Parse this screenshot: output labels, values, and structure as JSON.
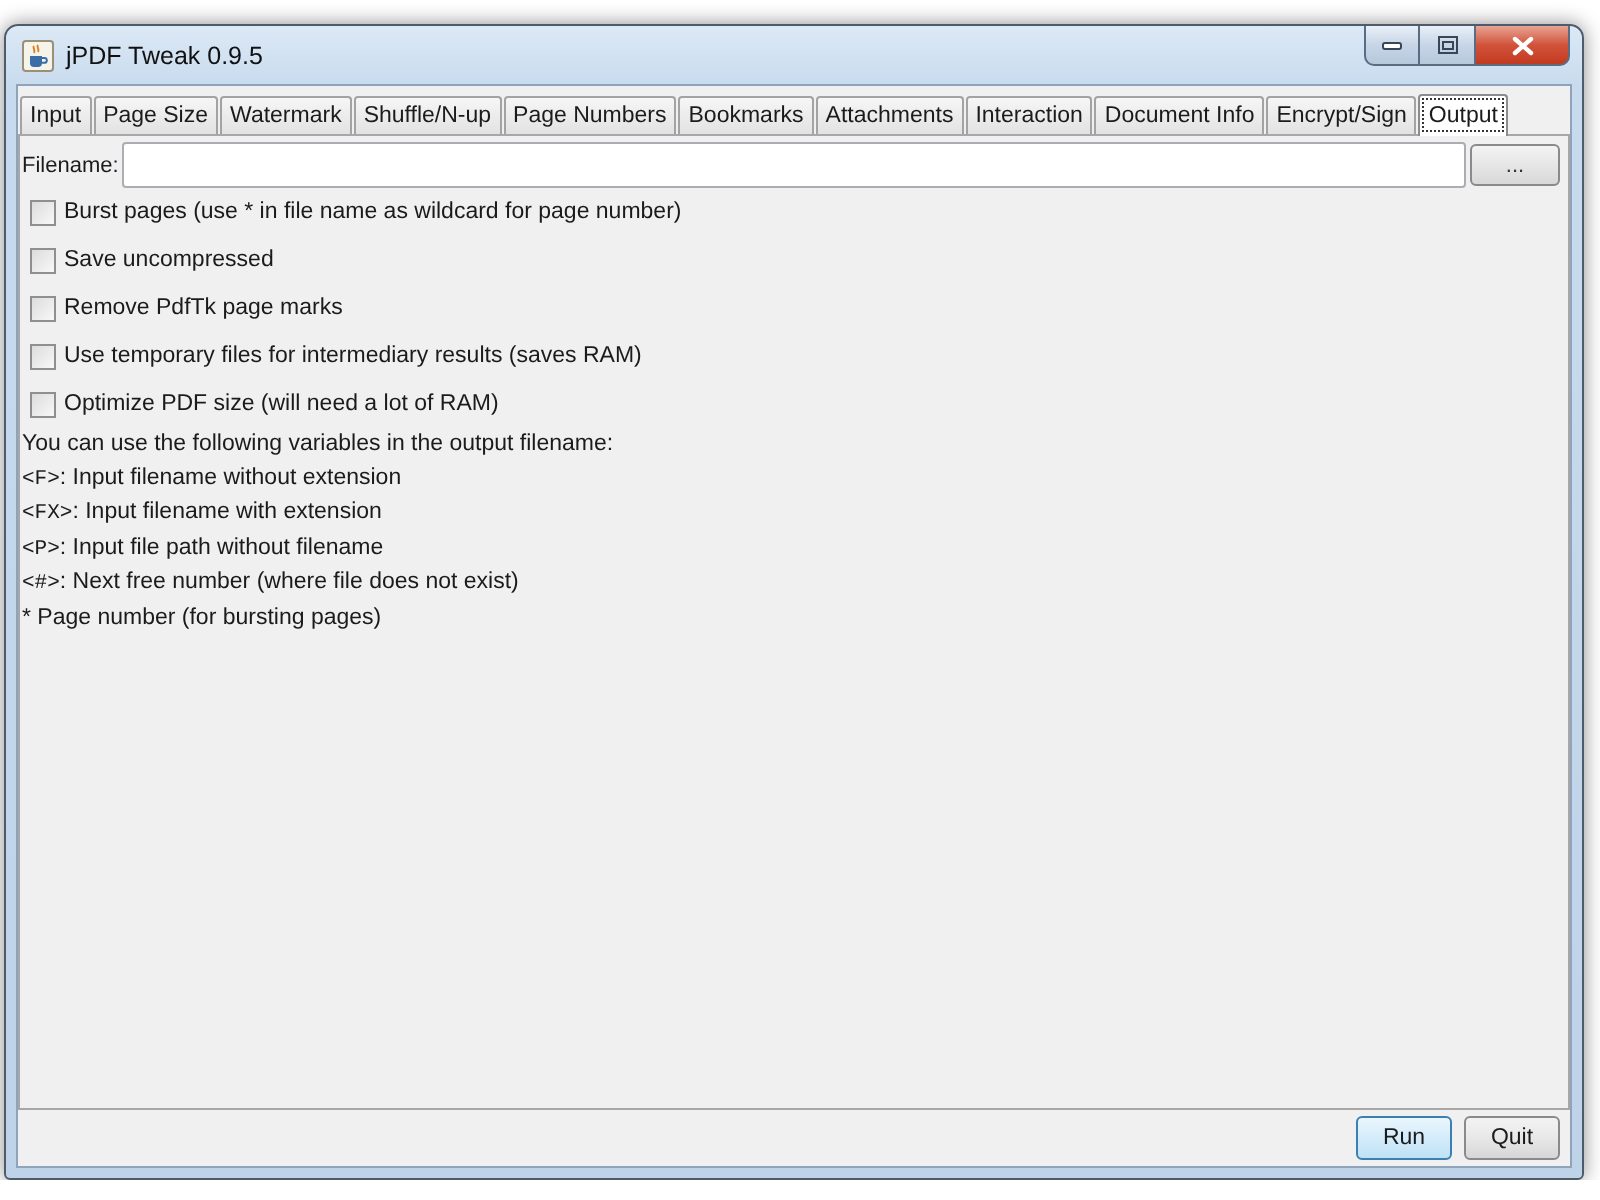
{
  "window": {
    "title": "jPDF Tweak 0.9.5"
  },
  "tabs": [
    {
      "label": "Input",
      "selected": false
    },
    {
      "label": "Page Size",
      "selected": false
    },
    {
      "label": "Watermark",
      "selected": false
    },
    {
      "label": "Shuffle/N-up",
      "selected": false
    },
    {
      "label": "Page Numbers",
      "selected": false
    },
    {
      "label": "Bookmarks",
      "selected": false
    },
    {
      "label": "Attachments",
      "selected": false
    },
    {
      "label": "Interaction",
      "selected": false
    },
    {
      "label": "Document Info",
      "selected": false
    },
    {
      "label": "Encrypt/Sign",
      "selected": false
    },
    {
      "label": "Output",
      "selected": true
    }
  ],
  "filename": {
    "label": "Filename:",
    "browse_button": "..."
  },
  "options": [
    {
      "label": "Burst pages (use * in file name as wildcard for page number)",
      "checked": false
    },
    {
      "label": "Save uncompressed",
      "checked": false
    },
    {
      "label": "Remove PdfTk page marks",
      "checked": false
    },
    {
      "label": "Use temporary files for intermediary results (saves RAM)",
      "checked": false
    },
    {
      "label": "Optimize PDF size (will need a lot of RAM)",
      "checked": false
    }
  ],
  "help": {
    "intro": "You can use the following variables in the output filename:",
    "variables": [
      {
        "code": "<F>",
        "text": ": Input filename without extension"
      },
      {
        "code": "<FX>",
        "text": ": Input filename with extension"
      },
      {
        "code": "<P>",
        "text": ": Input file path without filename"
      },
      {
        "code": "<#>",
        "text": ": Next free number (where file does not exist)"
      },
      {
        "text": "* Page number (for bursting pages)"
      }
    ]
  },
  "buttons": [
    {
      "label": "Run",
      "default": true
    },
    {
      "label": "Quit",
      "default": false
    }
  ]
}
